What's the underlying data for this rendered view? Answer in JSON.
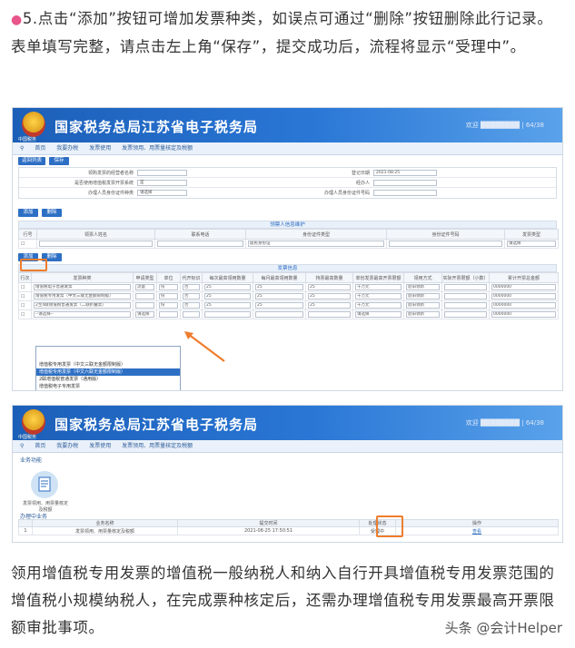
{
  "intro": {
    "bullet": "●",
    "text": "5.点击“添加”按钮可增加发票种类，如误点可通过“删除”按钮删除此行记录。表单填写完整，请点击左上角“保存”，提交成功后，流程将显示“受理中”。"
  },
  "screen1": {
    "brand_title": "国家税务总局江苏省电子税务局",
    "emblem_caption": "中国税务",
    "user_info": "欢迎 ████████ | 64/38",
    "breadcrumb": [
      "首页",
      "我要办税",
      "发票使用",
      "发票领用、用票量核定及税额"
    ],
    "toolbar": {
      "save": "返回列表",
      "reset": "保存"
    },
    "form_rows": [
      {
        "label": "领购发票的经营者名称",
        "value": "",
        "label2": "登记日期",
        "value2": "2021-08-25"
      },
      {
        "label": "是否使用增值税发票开票系统",
        "value": "是",
        "label2": "经办人",
        "value2": ""
      },
      {
        "label": "办理人员身份证件种类",
        "value": "请选择",
        "label2": "办理人员身份证件号码",
        "value2": ""
      }
    ],
    "buttons_a": {
      "add": "添加",
      "del": "删除"
    },
    "purchaser_section": "领票人信息维护",
    "purchaser_headers": [
      "行号",
      "领票人姓名",
      "联系电话",
      "身份证件类型",
      "身份证件号码",
      "发票类型"
    ],
    "purchaser_row": {
      "id_type": "居民身份证",
      "ticket_type": "请选择"
    },
    "buttons_b": {
      "add": "添加",
      "del": "删除"
    },
    "invoice_section": "发票信息",
    "invoice_headers": [
      "行次",
      "发票种类",
      "申请类型",
      "单位",
      "代开标识",
      "每次最高领用数量",
      "每月最高领用数量",
      "持票最高数量",
      "单份发票最高开票限额",
      "领用方式",
      "实际开票限额（小数）",
      "累计开票总金额"
    ],
    "invoice_rows": [
      {
        "kind": "增值税电子普通发票",
        "apply": "流量",
        "unit": "份",
        "agent": "否",
        "per": "25",
        "month": "25",
        "hold": "25",
        "limit": "十万元",
        "method": "验旧领新",
        "real": "",
        "total": "0000000"
      },
      {
        "kind": "增值税专用发票（中文三联无金额限制版）",
        "apply": "",
        "unit": "份",
        "agent": "否",
        "per": "25",
        "month": "25",
        "hold": "25",
        "limit": "十万元",
        "method": "验旧领新",
        "real": "",
        "total": "0000000"
      },
      {
        "kind": "2至4联增值税普通发票（二联折叠票）",
        "apply": "",
        "unit": "份",
        "agent": "否",
        "per": "25",
        "month": "25",
        "hold": "25",
        "limit": "十万元",
        "method": "验旧领新",
        "real": "",
        "total": "0000000"
      },
      {
        "kind": "--请选择--",
        "apply": "请选择",
        "unit": "",
        "agent": "",
        "per": "",
        "month": "",
        "hold": "",
        "limit": "请选择",
        "method": "验旧领新",
        "real": "",
        "total": "0000000"
      }
    ],
    "dropdown_options": [
      "增值税专用发票（中文三联无金额限制版）",
      "增值税专用发票（中文六联无金额限制版）",
      "2联增值税普通发票（通用版）",
      "增值税电子专用发票"
    ],
    "dropdown_selected_index": 1
  },
  "screen2": {
    "brand_title": "国家税务总局江苏省电子税务局",
    "emblem_caption": "中国税务",
    "user_info": "欢迎 ████████ | 64/38",
    "breadcrumb": [
      "首页",
      "我要办税",
      "发票使用",
      "发票领用、用票量核定及税额"
    ],
    "service_section": "业务功能",
    "service_label": "发票领用、用票量核定及税额",
    "pending_section": "办理中业务",
    "table_headers": [
      "序号",
      "业务名称",
      "提交时间",
      "处理状态",
      "操作"
    ],
    "table_row": {
      "no": "1",
      "name": "发票领用、用票量核定及税额",
      "time": "2021-08-25 17:50:51",
      "status": "受理中",
      "op": "查看"
    }
  },
  "closing": {
    "text": "领用增值税专用发票的增值税一般纳税人和纳入自行开具增值税专用发票范围的增值税小规模纳税人，在完成票种核定后，还需办理增值税专用发票最高开票限额审批事项。"
  },
  "watermark": "头条 @会计Helper",
  "colors": {
    "brand_blue": "#2a77d6",
    "highlight": "#ef7d2d",
    "bullet": "#e8558a"
  }
}
